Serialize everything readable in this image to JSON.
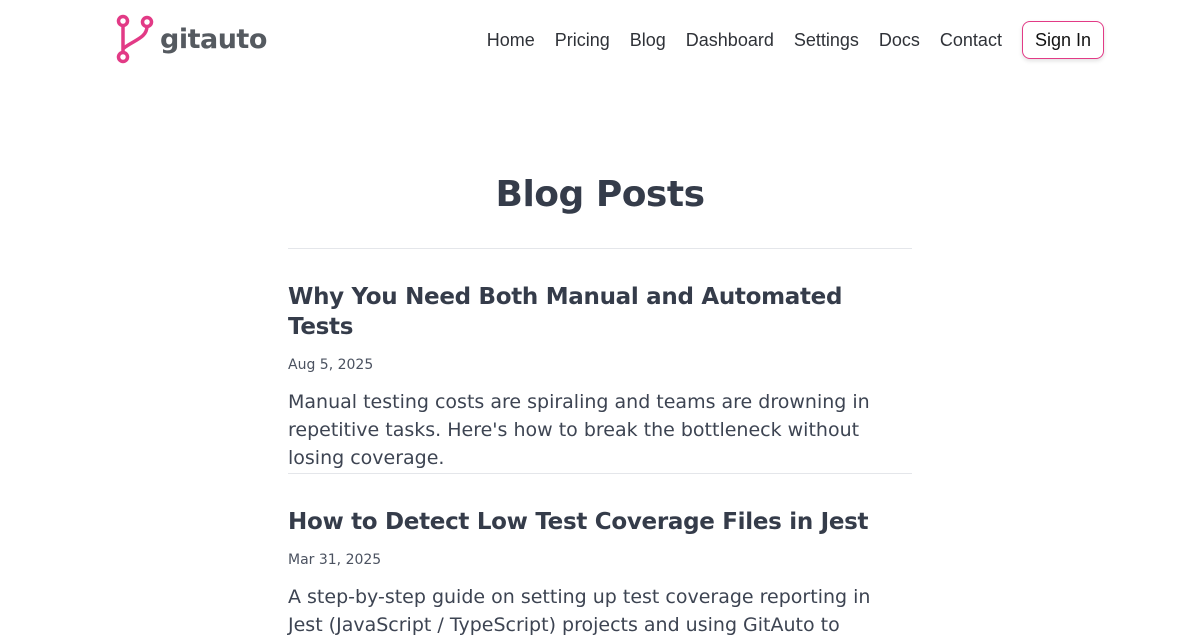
{
  "brand": {
    "name": "gitauto",
    "logo_icon": "git-branch-icon",
    "accent_color": "#e23a86"
  },
  "nav": {
    "items": [
      {
        "label": "Home"
      },
      {
        "label": "Pricing"
      },
      {
        "label": "Blog"
      },
      {
        "label": "Dashboard"
      },
      {
        "label": "Settings"
      },
      {
        "label": "Docs"
      },
      {
        "label": "Contact"
      }
    ],
    "sign_in_label": "Sign In"
  },
  "page": {
    "title": "Blog Posts"
  },
  "posts": [
    {
      "title": "Why You Need Both Manual and Automated Tests",
      "date": "Aug 5, 2025",
      "excerpt": "Manual testing costs are spiraling and teams are drowning in repetitive tasks. Here's how to break the bottleneck without losing coverage."
    },
    {
      "title": "How to Detect Low Test Coverage Files in Jest",
      "date": "Mar 31, 2025",
      "excerpt": "A step-by-step guide on setting up test coverage reporting in Jest (JavaScript / TypeScript) projects and using GitAuto to"
    }
  ]
}
